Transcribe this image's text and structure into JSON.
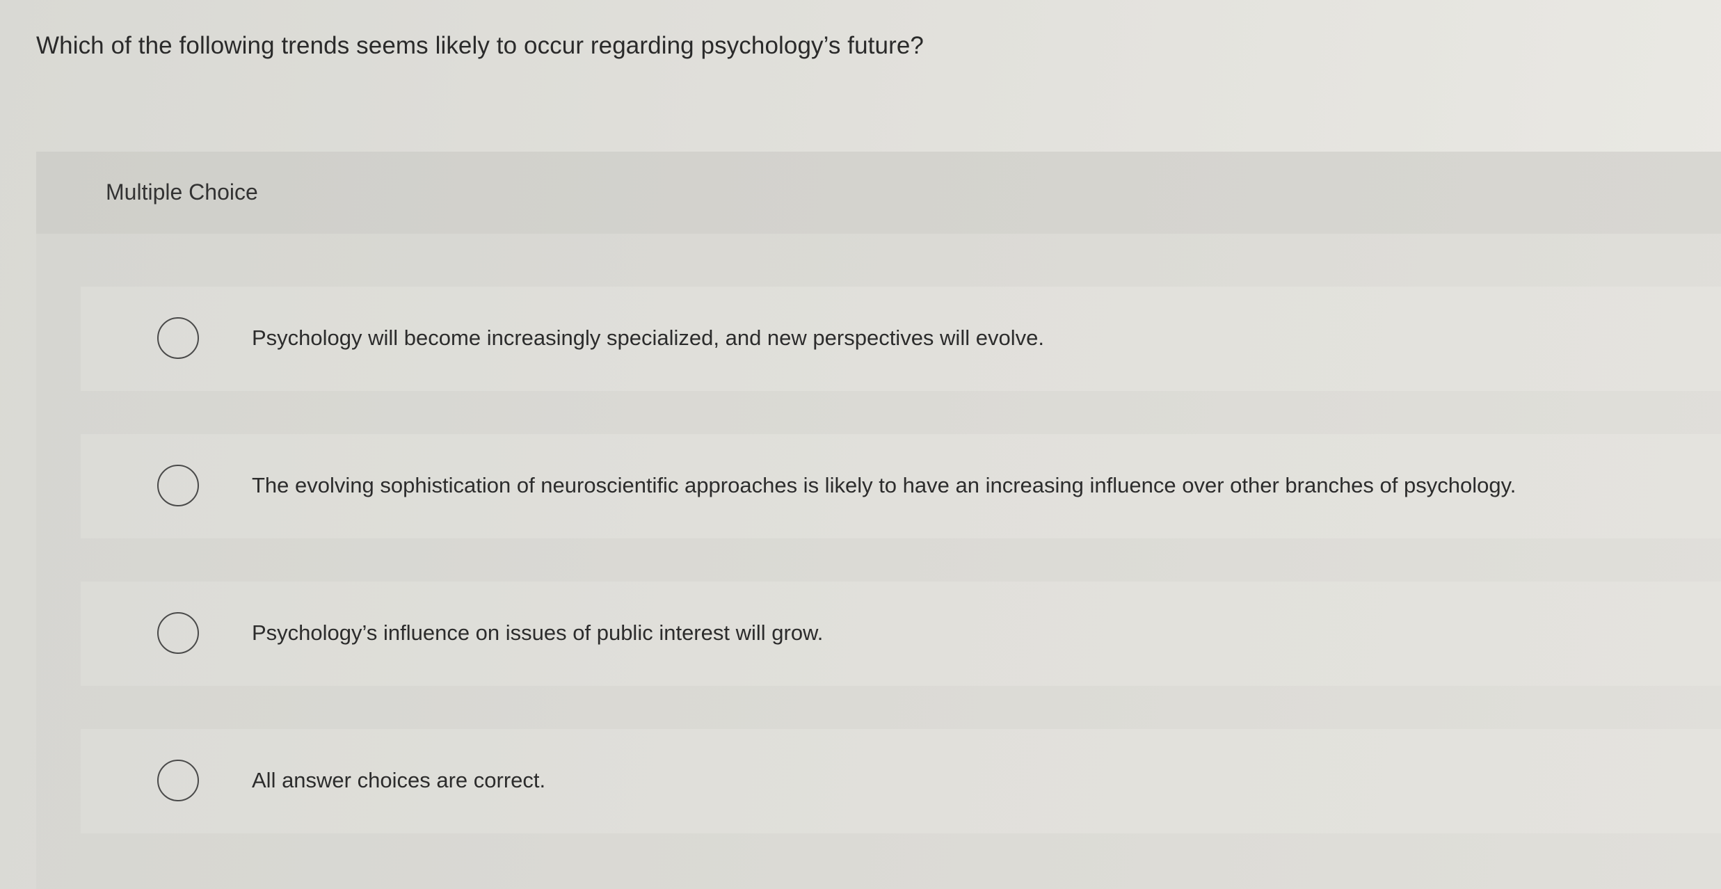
{
  "question": "Which of the following trends seems likely to occur regarding psychology’s future?",
  "panel": {
    "label": "Multiple Choice"
  },
  "options": [
    {
      "text": "Psychology will become increasingly specialized, and new perspectives will evolve.",
      "selected": false
    },
    {
      "text": "The evolving sophistication of neuroscientific approaches is likely to have an increasing influence over other branches of psychology.",
      "selected": false
    },
    {
      "text": "Psychology’s influence on issues of public interest will grow.",
      "selected": false
    },
    {
      "text": "All answer choices are correct.",
      "selected": false
    }
  ],
  "colors": {
    "text": "#2b2b2b",
    "radio_border": "#4a4a4a"
  }
}
